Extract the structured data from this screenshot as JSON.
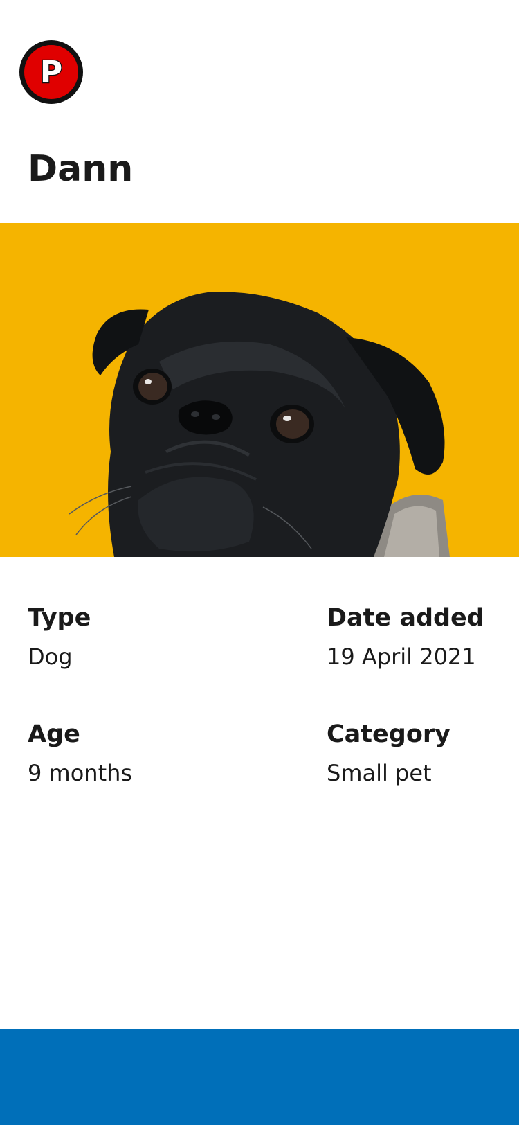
{
  "brand": {
    "logo_letter": "P",
    "logo_color": "#e00000"
  },
  "pet": {
    "name": "Dann",
    "photo_icon": "pug-photo",
    "photo_background": "#f5b400"
  },
  "details": [
    {
      "label": "Type",
      "value": "Dog"
    },
    {
      "label": "Date added",
      "value": "19 April 2021"
    },
    {
      "label": "Age",
      "value": "9 months"
    },
    {
      "label": "Category",
      "value": "Small pet"
    }
  ],
  "footer": {
    "color": "#006fb9"
  }
}
